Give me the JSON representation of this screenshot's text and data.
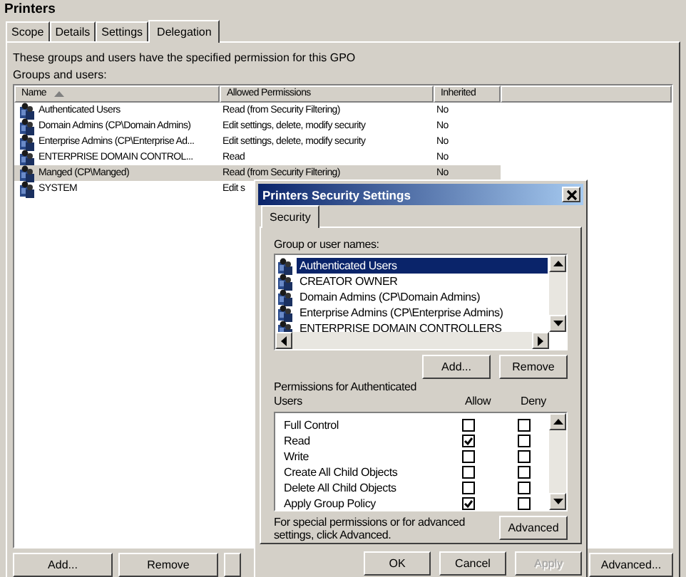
{
  "window": {
    "title": "Printers"
  },
  "tabs": [
    {
      "label": "Scope",
      "selected": false
    },
    {
      "label": "Details",
      "selected": false
    },
    {
      "label": "Settings",
      "selected": false
    },
    {
      "label": "Delegation",
      "selected": true
    }
  ],
  "description": "These groups and users have the specified permission for this GPO",
  "list_label": "Groups and users:",
  "table": {
    "columns": [
      {
        "label": "Name",
        "sorted": true
      },
      {
        "label": "Allowed Permissions",
        "sorted": false
      },
      {
        "label": "Inherited",
        "sorted": false
      }
    ],
    "rows": [
      {
        "name": "Authenticated Users",
        "permissions": "Read (from Security Filtering)",
        "inherited": "No",
        "selected": false
      },
      {
        "name": "Domain Admins (CP\\Domain Admins)",
        "permissions": "Edit settings, delete, modify security",
        "inherited": "No",
        "selected": false
      },
      {
        "name": "Enterprise Admins (CP\\Enterprise Ad...",
        "permissions": "Edit settings, delete, modify security",
        "inherited": "No",
        "selected": false
      },
      {
        "name": "ENTERPRISE DOMAIN CONTROL...",
        "permissions": "Read",
        "inherited": "No",
        "selected": false
      },
      {
        "name": "Manged (CP\\Manged)",
        "permissions": "Read (from Security Filtering)",
        "inherited": "No",
        "selected": true
      },
      {
        "name": "SYSTEM",
        "permissions": "Edit s",
        "selected": false
      }
    ]
  },
  "buttons": [
    {
      "label": "Add...",
      "kind": "left"
    },
    {
      "label": "Remove",
      "kind": "left"
    },
    {
      "label": "Advanced...",
      "kind": "right"
    }
  ],
  "dialog": {
    "title": "Printers Security Settings",
    "tabs": [
      {
        "label": "Security",
        "selected": true
      }
    ],
    "group_label": "Group or user names:",
    "users": [
      {
        "name": "Authenticated Users",
        "selected": true
      },
      {
        "name": "CREATOR OWNER",
        "selected": false
      },
      {
        "name": "Domain Admins (CP\\Domain Admins)",
        "selected": false
      },
      {
        "name": "Enterprise Admins (CP\\Enterprise Admins)",
        "selected": false
      },
      {
        "name": "ENTERPRISE DOMAIN CONTROLLERS",
        "selected": false
      }
    ],
    "user_buttons": [
      "Add...",
      "Remove"
    ],
    "permissions_label": "Permissions for Authenticated Users",
    "allow_header": "Allow",
    "deny_header": "Deny",
    "permissions": [
      {
        "name": "Full Control",
        "allow": false,
        "deny": false
      },
      {
        "name": "Read",
        "allow": true,
        "deny": false
      },
      {
        "name": "Write",
        "allow": false,
        "deny": false
      },
      {
        "name": "Create All Child Objects",
        "allow": false,
        "deny": false
      },
      {
        "name": "Delete All Child Objects",
        "allow": false,
        "deny": false
      },
      {
        "name": "Apply Group Policy",
        "allow": true,
        "deny": false
      }
    ],
    "advanced_note": "For special permissions or for advanced settings, click Advanced.",
    "advanced_button": "Advanced",
    "footer_buttons": [
      {
        "label": "OK",
        "disabled": false
      },
      {
        "label": "Cancel",
        "disabled": false
      },
      {
        "label": "Apply",
        "disabled": true
      }
    ]
  }
}
